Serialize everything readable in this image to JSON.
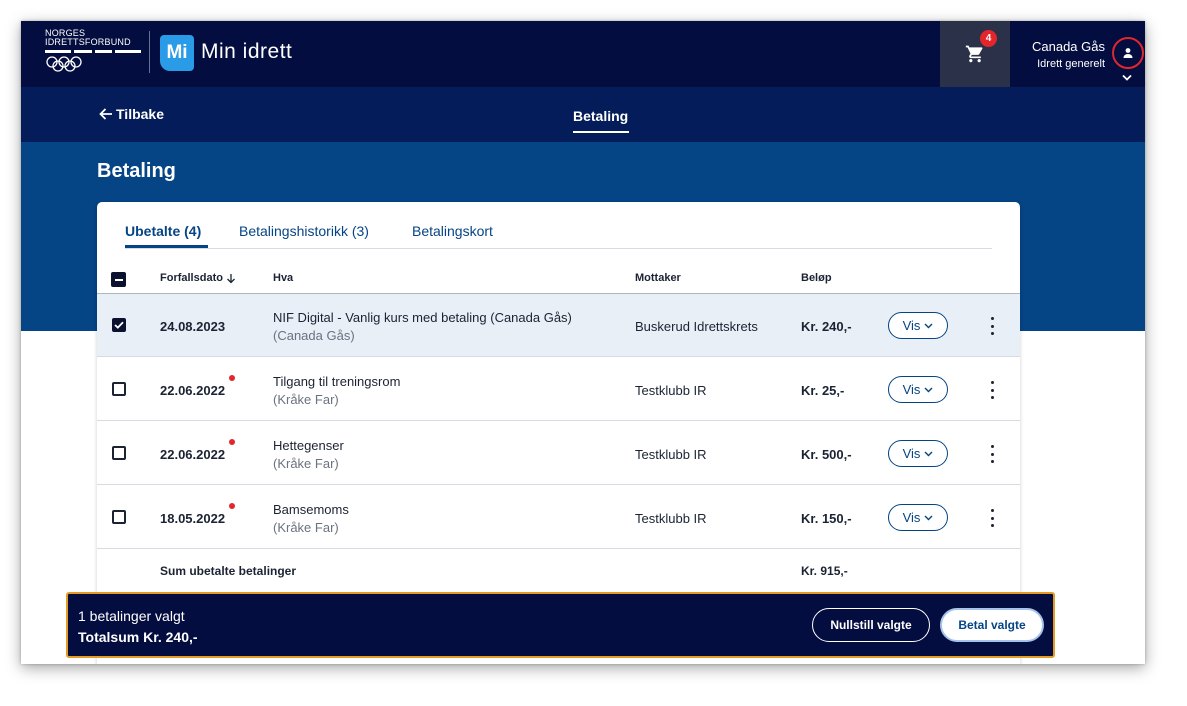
{
  "header": {
    "org_line1": "NORGES",
    "org_line2": "IDRETTSFORBUND",
    "app_badge": "Mi",
    "app_name": "Min idrett",
    "cart_count": "4",
    "user_name": "Canada Gås",
    "user_context": "Idrett generelt"
  },
  "subnav": {
    "back_label": "Tilbake",
    "active_tab": "Betaling"
  },
  "page": {
    "title": "Betaling"
  },
  "tabs": [
    {
      "label": "Ubetalte (4)",
      "active": true
    },
    {
      "label": "Betalingshistorikk (3)",
      "active": false
    },
    {
      "label": "Betalingskort",
      "active": false
    }
  ],
  "table": {
    "columns": {
      "due_date": "Forfallsdato",
      "what": "Hva",
      "recipient": "Mottaker",
      "amount": "Beløp"
    },
    "action_label": "Vis",
    "rows": [
      {
        "checked": true,
        "overdue": false,
        "date": "24.08.2023",
        "title": "NIF Digital - Vanlig kurs med betaling (Canada Gås)",
        "person": "(Canada Gås)",
        "recipient": "Buskerud Idrettskrets",
        "amount": "Kr. 240,-"
      },
      {
        "checked": false,
        "overdue": true,
        "date": "22.06.2022",
        "title": "Tilgang til treningsrom",
        "person": "(Kråke Far)",
        "recipient": "Testklubb IR",
        "amount": "Kr. 25,-"
      },
      {
        "checked": false,
        "overdue": true,
        "date": "22.06.2022",
        "title": "Hettegenser",
        "person": "(Kråke Far)",
        "recipient": "Testklubb IR",
        "amount": "Kr. 500,-"
      },
      {
        "checked": false,
        "overdue": true,
        "date": "18.05.2022",
        "title": "Bamsemoms",
        "person": "(Kråke Far)",
        "recipient": "Testklubb IR",
        "amount": "Kr. 150,-"
      }
    ],
    "sum_label": "Sum ubetalte betalinger",
    "sum_value": "Kr. 915,-"
  },
  "selection_bar": {
    "count_text": "1 betalinger valgt",
    "total_text": "Totalsum Kr. 240,-",
    "reset_label": "Nullstill valgte",
    "pay_label": "Betal valgte"
  },
  "colors": {
    "topbar": "#040d3f",
    "subnav": "#041c59",
    "hero": "#054485",
    "accent_badge": "#2a9be6",
    "notification_red": "#e3262b",
    "selected_row": "#e9eff6",
    "highlight_border": "#e69b25"
  },
  "icons": {
    "back": "arrow-left-icon",
    "cart": "cart-icon",
    "user": "user-icon",
    "sort": "arrow-down-icon",
    "chevron": "chevron-down-icon",
    "more": "kebab-icon"
  }
}
